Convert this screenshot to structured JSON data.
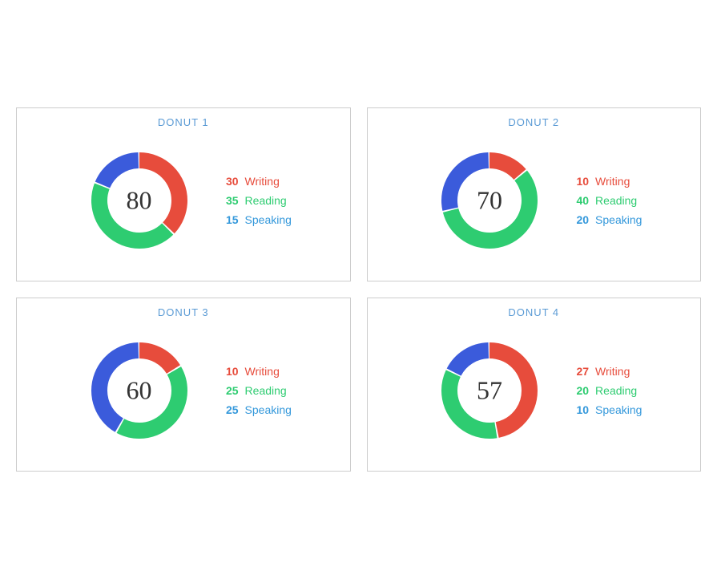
{
  "donuts": [
    {
      "id": "donut1",
      "title": "DONUT 1",
      "center": "80",
      "segments": [
        {
          "label": "Writing",
          "value": 30,
          "color": "#e74c3c"
        },
        {
          "label": "Reading",
          "value": 35,
          "color": "#2ecc71"
        },
        {
          "label": "Speaking",
          "value": 15,
          "color": "#3b5bdb"
        }
      ]
    },
    {
      "id": "donut2",
      "title": "DONUT 2",
      "center": "70",
      "segments": [
        {
          "label": "Writing",
          "value": 10,
          "color": "#e74c3c"
        },
        {
          "label": "Reading",
          "value": 40,
          "color": "#2ecc71"
        },
        {
          "label": "Speaking",
          "value": 20,
          "color": "#3b5bdb"
        }
      ]
    },
    {
      "id": "donut3",
      "title": "DONUT 3",
      "center": "60",
      "segments": [
        {
          "label": "Writing",
          "value": 10,
          "color": "#e74c3c"
        },
        {
          "label": "Reading",
          "value": 25,
          "color": "#2ecc71"
        },
        {
          "label": "Speaking",
          "value": 25,
          "color": "#3b5bdb"
        }
      ]
    },
    {
      "id": "donut4",
      "title": "DONUT 4",
      "center": "57",
      "segments": [
        {
          "label": "Writing",
          "value": 27,
          "color": "#e74c3c"
        },
        {
          "label": "Reading",
          "value": 20,
          "color": "#2ecc71"
        },
        {
          "label": "Speaking",
          "value": 10,
          "color": "#3b5bdb"
        }
      ]
    }
  ]
}
